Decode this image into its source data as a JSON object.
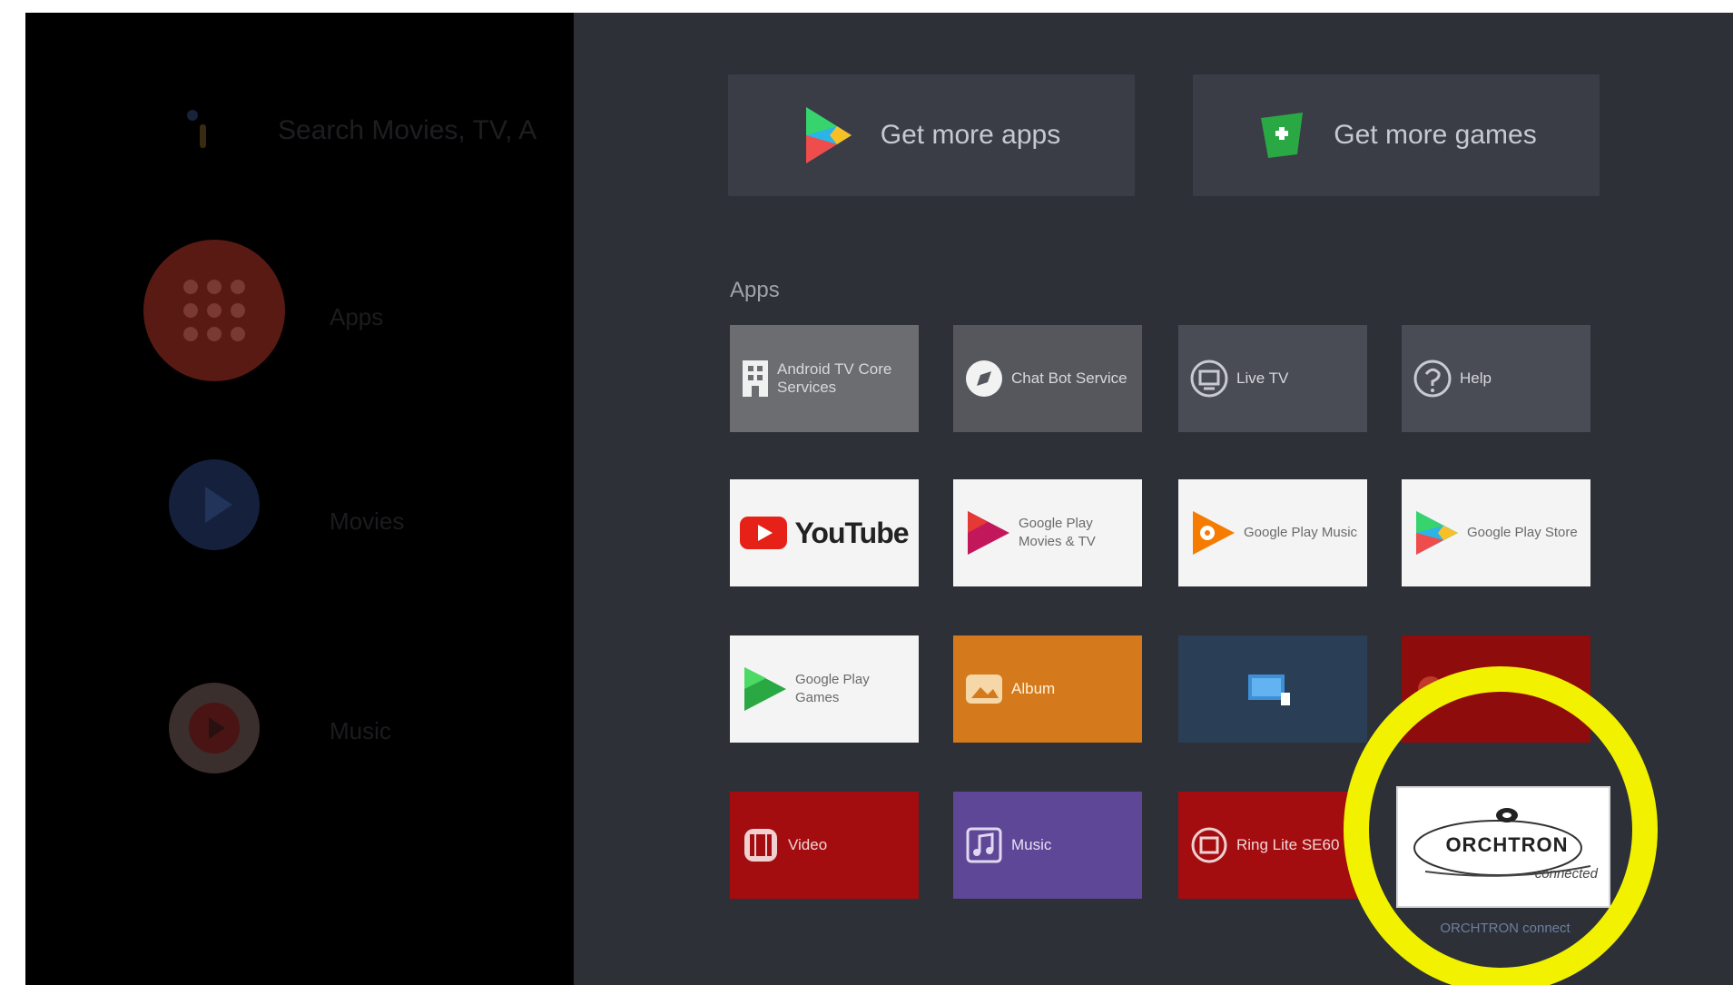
{
  "left_panel": {
    "search_text": "Search Movies, TV, A",
    "menu": [
      {
        "label": "Apps",
        "icon": "apps-grid-icon",
        "color": "#5a1a14"
      },
      {
        "label": "Movies",
        "icon": "play-icon",
        "color": "#15213c"
      },
      {
        "label": "Music",
        "icon": "youtube-icon",
        "color": "#3a2f2c"
      }
    ]
  },
  "top_buttons": {
    "get_more_apps": "Get more apps",
    "get_more_games": "Get more games"
  },
  "apps_section_label": "Apps",
  "apps": [
    {
      "label": "Android TV Core Services",
      "style": "dark",
      "bg": "#6b6d70",
      "icon": "building-icon"
    },
    {
      "label": "Chat Bot Service",
      "style": "dark",
      "bg": "#55575d",
      "icon": "compass-icon"
    },
    {
      "label": "Live TV",
      "style": "dark",
      "bg": "#494c55",
      "icon": "tv-icon"
    },
    {
      "label": "Help",
      "style": "dark",
      "bg": "#494c55",
      "icon": "help-icon"
    },
    {
      "label": "YouTube",
      "style": "light",
      "icon": "youtube-icon"
    },
    {
      "label": "Google Play Movies & TV",
      "style": "light",
      "icon": "play-movies-icon"
    },
    {
      "label": "Google Play Music",
      "style": "light",
      "icon": "play-music-icon"
    },
    {
      "label": "Google Play Store",
      "style": "light",
      "icon": "play-store-icon"
    },
    {
      "label": "Google Play Games",
      "style": "light",
      "icon": "play-games-icon"
    },
    {
      "label": "Album",
      "style": "dark",
      "bg": "#d47a1c",
      "icon": "album-icon"
    },
    {
      "label": "",
      "style": "dark",
      "bg": "#2a3e55",
      "icon": "screen-share-icon"
    },
    {
      "label": "",
      "style": "dark",
      "bg": "#8f0c0c",
      "icon": "app-icon"
    },
    {
      "label": "Video",
      "style": "red",
      "icon": "video-icon"
    },
    {
      "label": "Music",
      "style": "dark",
      "bg": "#5e4796",
      "icon": "music-icon"
    },
    {
      "label": "Ring Lite SE60",
      "style": "red",
      "icon": "ring-icon"
    }
  ],
  "focused_app": {
    "brand": "ORCHTRON",
    "tagline": "connected",
    "caption": "ORCHTRON connect"
  },
  "colors": {
    "background": "#2d3037",
    "highlight": "#f2f200"
  }
}
